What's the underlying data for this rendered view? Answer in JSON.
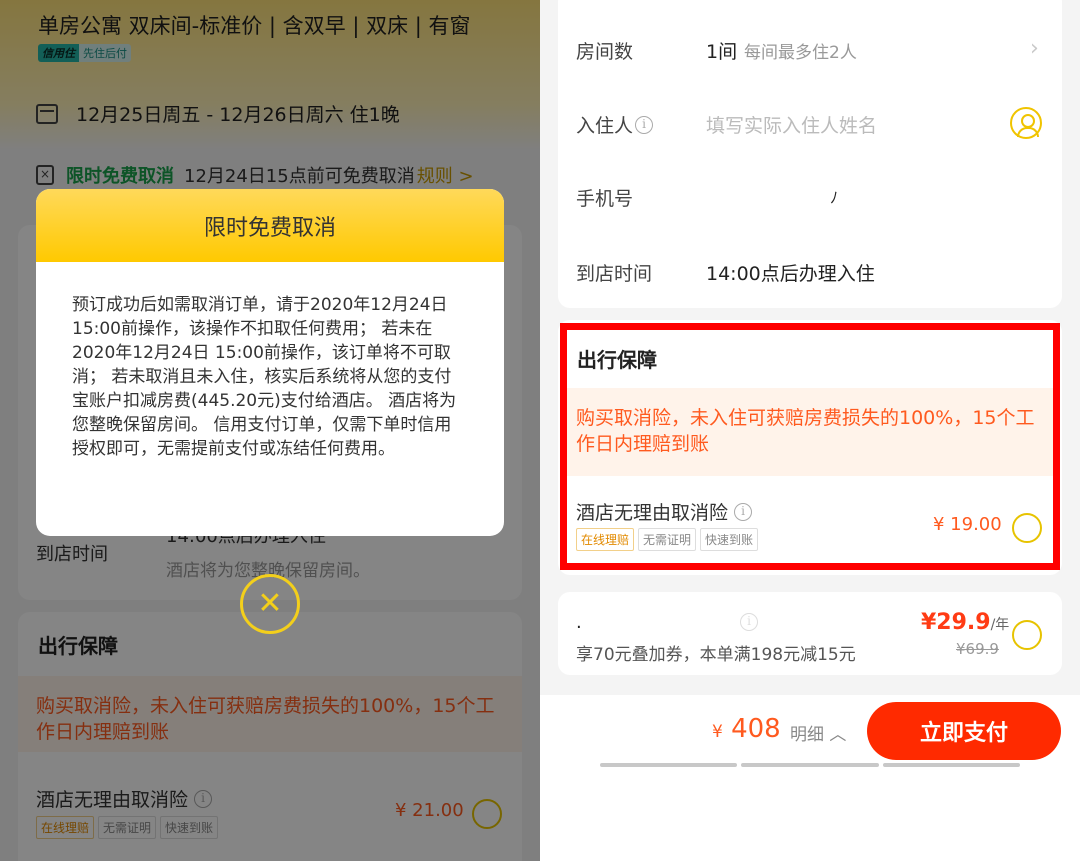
{
  "left": {
    "room_title": "单房公寓 双床间-标准价 | 含双早 | 双床 | 有窗",
    "credit_tag_1": "信用住",
    "credit_tag_2": "先住后付",
    "date_range": "12月25日周五 - 12月26日周六 住1晚",
    "cancel_badge": "限时免费取消",
    "cancel_text": "12月24日15点前可免费取消",
    "rule_link": "规则 >",
    "arrive_label": "到店时间",
    "arrive_value": "14:00点后办理入住",
    "arrive_sub": "酒店将为您整晚保留房间。",
    "guarantee_title": "出行保障",
    "promo_text": "购买取消险，未入住可获赔房费损失的100%，15个工作日内理赔到账",
    "insurance_name": "酒店无理由取消险",
    "tags": [
      "在线理赔",
      "无需证明",
      "快速到账"
    ],
    "price": "¥ 21.00",
    "modal": {
      "title": "限时免费取消",
      "body": "预订成功后如需取消订单，请于2020年12月24日 15:00前操作，该操作不扣取任何费用； 若未在2020年12月24日 15:00前操作，该订单将不可取消； 若未取消且未入住，核实后系统将从您的支付宝账户扣减房费(445.20元)支付给酒店。 酒店将为您整晚保留房间。 信用支付订单，仅需下单时信用授权即可，无需提前支付或冻结任何费用。",
      "close": "✕"
    }
  },
  "right": {
    "rooms_label": "房间数",
    "rooms_value": "1间",
    "rooms_hint": "每间最多住2人",
    "guest_label": "入住人",
    "guest_placeholder": "填写实际入住人姓名",
    "phone_label": "手机号",
    "phone_value": "ﾉ",
    "arrive_label": "到店时间",
    "arrive_value": "14:00点后办理入住",
    "guarantee_title": "出行保障",
    "promo_text": "购买取消险，未入住可获赔房费损失的100%，15个工作日内理赔到账",
    "insurance_name": "酒店无理由取消险",
    "tags": [
      "在线理赔",
      "无需证明",
      "快速到账"
    ],
    "price": "¥ 19.00",
    "card2": {
      "name": ".",
      "desc": "享70元叠加券，本单满198元减15元",
      "price": "¥29.9",
      "price_unit": "/年",
      "old_price": "¥69.9"
    },
    "total_currency": "¥",
    "total_price": "408",
    "detail_link": "明细 ︿",
    "pay_button": "立即支付"
  },
  "colors": {
    "accent_yellow": "#ffc900",
    "orange_text": "#ff5a1f",
    "pay_red": "#ff2a00",
    "highlight_border": "#ff0000",
    "green": "#19a24c"
  }
}
